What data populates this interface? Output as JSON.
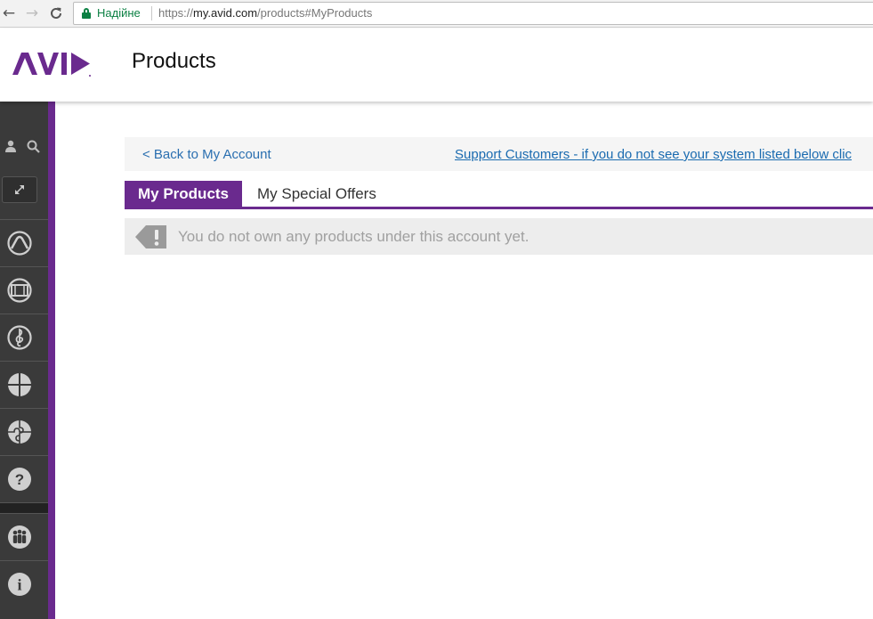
{
  "browser": {
    "back_icon": "back-arrow-icon",
    "forward_icon": "forward-arrow-icon",
    "reload_icon": "reload-icon",
    "security_label": "Надійне",
    "url_protocol": "https://",
    "url_host": "my.avid.com",
    "url_path": "/products#MyProducts"
  },
  "header": {
    "logo_text": "AVID",
    "title": "Products"
  },
  "sidebar": {
    "accent_color": "#6a2a8e",
    "top_icons": [
      "user-icon",
      "search-icon",
      "expand-icon"
    ],
    "items": [
      {
        "icon": "pro-tools-icon"
      },
      {
        "icon": "media-composer-icon"
      },
      {
        "icon": "sibelius-icon"
      },
      {
        "icon": "crosshair-icon"
      },
      {
        "icon": "puzzle-icon"
      },
      {
        "icon": "help-icon",
        "glyph": "?"
      },
      {
        "icon": "community-icon"
      },
      {
        "icon": "info-icon",
        "glyph": "i"
      }
    ]
  },
  "main": {
    "back_link": "< Back to My Account",
    "support_link": "Support Customers - if you do not see your system listed below clic",
    "tabs": [
      {
        "label": "My Products",
        "active": true
      },
      {
        "label": "My Special Offers",
        "active": false
      }
    ],
    "notice": {
      "icon": "exclamation-tag-icon",
      "text": "You do not own any products under this account yet."
    }
  },
  "colors": {
    "brand_purple": "#6a2a8e",
    "link_blue": "#1a6bb0",
    "secure_green": "#0b8043"
  }
}
